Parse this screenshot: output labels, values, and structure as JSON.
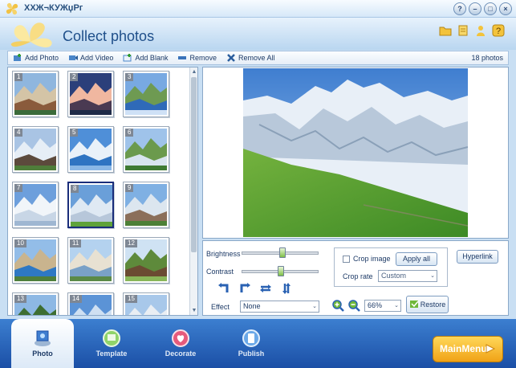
{
  "window": {
    "title": "ХХЖ¬КУЖџРг"
  },
  "header": {
    "title": "Collect photos"
  },
  "toolbar": {
    "add_photo": "Add Photo",
    "add_video": "Add Video",
    "add_blank": "Add Blank",
    "remove": "Remove",
    "remove_all": "Remove All",
    "count": "18 photos"
  },
  "thumbnails": [
    {
      "n": "1",
      "scene": "town"
    },
    {
      "n": "2",
      "scene": "peak"
    },
    {
      "n": "3",
      "scene": "lake"
    },
    {
      "n": "4",
      "scene": "village"
    },
    {
      "n": "5",
      "scene": "alps-lake"
    },
    {
      "n": "6",
      "scene": "valley"
    },
    {
      "n": "7",
      "scene": "snow"
    },
    {
      "n": "8",
      "scene": "meadow",
      "selected": true
    },
    {
      "n": "9",
      "scene": "mountain-town"
    },
    {
      "n": "10",
      "scene": "castle-lake"
    },
    {
      "n": "11",
      "scene": "chateau"
    },
    {
      "n": "12",
      "scene": "tree"
    },
    {
      "n": "13",
      "scene": "forest"
    },
    {
      "n": "14",
      "scene": "sky"
    },
    {
      "n": "15",
      "scene": "church"
    }
  ],
  "controls": {
    "brightness_label": "Brightness",
    "contrast_label": "Contrast",
    "brightness_level": 0.52,
    "contrast_level": 0.5,
    "effect_label": "Effect",
    "effect_value": "None",
    "crop_image_label": "Crop image",
    "crop_image_checked": false,
    "apply_all": "Apply all",
    "crop_rate_label": "Crop rate",
    "crop_rate_value": "Custom",
    "hyperlink": "Hyperlink",
    "zoom_value": "66%",
    "restore": "Restore"
  },
  "nav": {
    "photo": "Photo",
    "template": "Template",
    "decorate": "Decorate",
    "publish": "Publish",
    "main_menu": "MainMenu"
  },
  "colors": {
    "accent": "#2d6fc4",
    "header_bg": "#c9dff3",
    "main_menu": "#f6b52c"
  }
}
